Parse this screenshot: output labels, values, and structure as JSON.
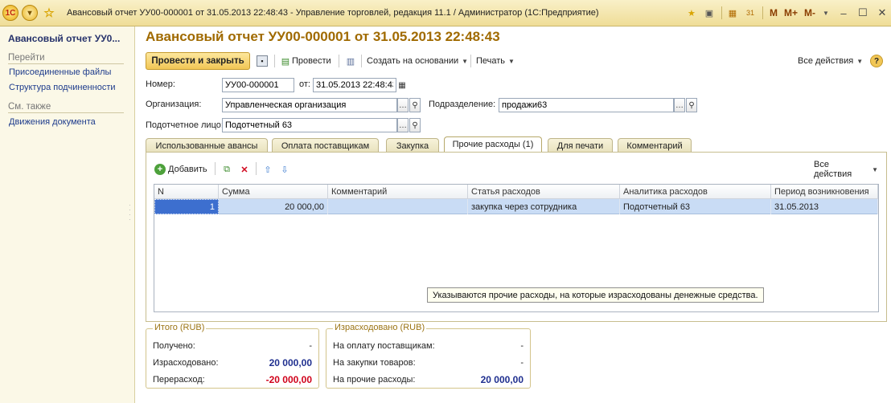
{
  "window": {
    "app_logo": "1С",
    "title": "Авансовый отчет УУ00-000001 от 31.05.2013 22:48:43 - Управление торговлей, редакция 11.1 / Администратор  (1С:Предприятие)",
    "m_buttons": [
      "M",
      "M+",
      "M-"
    ],
    "icons": [
      "star-icon",
      "history-icon",
      "calculator-icon",
      "calendar-icon",
      "minimize-icon",
      "maximize-icon",
      "close-icon"
    ]
  },
  "left_panel": {
    "title": "Авансовый отчет УУ0...",
    "goto_header": "Перейти",
    "goto_links": [
      "Присоединенные файлы",
      "Структура подчиненности"
    ],
    "see_also_header": "См. также",
    "see_also_links": [
      "Движения документа"
    ]
  },
  "document": {
    "title": "Авансовый отчет УУ00-000001 от 31.05.2013 22:48:43"
  },
  "toolbar": {
    "post_close": "Провести и закрыть",
    "post": "Провести",
    "create_based": "Создать на основании",
    "print": "Печать",
    "all_actions": "Все действия",
    "help": "?"
  },
  "form": {
    "number_label": "Номер:",
    "number_value": "УУ00-000001",
    "date_label": "от:",
    "date_value": "31.05.2013 22:48:43",
    "org_label": "Организация:",
    "org_value": "Управленческая организация",
    "dept_label": "Подразделение:",
    "dept_value": "продажи63",
    "person_label": "Подотчетное лицо:",
    "person_value": "Подотчетный 63"
  },
  "tabs": [
    {
      "label": "Использованные авансы",
      "active": false
    },
    {
      "label": "Оплата поставщикам",
      "active": false
    },
    {
      "label": "Закупка",
      "active": false
    },
    {
      "label": "Прочие расходы (1)",
      "active": true
    },
    {
      "label": "Для печати",
      "active": false
    },
    {
      "label": "Комментарий",
      "active": false
    }
  ],
  "table_toolbar": {
    "add": "Добавить",
    "all_actions": "Все действия"
  },
  "table": {
    "columns": [
      "N",
      "Сумма",
      "Комментарий",
      "Статья расходов",
      "Аналитика расходов",
      "Период возникновения"
    ],
    "rows": [
      {
        "n": "1",
        "sum": "20 000,00",
        "comment": "",
        "article": "закупка через сотрудника",
        "analytics": "Подотчетный 63",
        "period": "31.05.2013"
      }
    ]
  },
  "tooltip": "Указываются прочие расходы, на которые израсходованы денежные средства.",
  "totals": {
    "title": "Итого (RUB)",
    "received_label": "Получено:",
    "received_value": "-",
    "spent_label": "Израсходовано:",
    "spent_value": "20 000,00",
    "overspent_label": "Перерасход:",
    "overspent_value": "-20 000,00"
  },
  "spent": {
    "title": "Израсходовано (RUB)",
    "suppliers_label": "На оплату поставщикам:",
    "suppliers_value": "-",
    "goods_label": "На закупки товаров:",
    "goods_value": "-",
    "other_label": "На прочие расходы:",
    "other_value": "20 000,00"
  },
  "colors": {
    "title_gold": "#a06a00",
    "link_blue": "#1d3b8c",
    "value_blue": "#1f2f8f",
    "value_red": "#d0021b",
    "selection": "#c9dcf5"
  }
}
